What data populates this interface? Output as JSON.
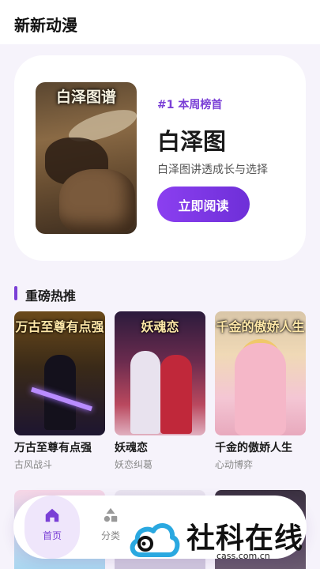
{
  "app": {
    "title": "新新动漫"
  },
  "hero": {
    "cover_title": "白泽图谱",
    "rank_label": "#1 本周榜首",
    "title": "白泽图",
    "description": "白泽图讲透成长与选择",
    "read_button": "立即阅读"
  },
  "section": {
    "title": "重磅热推"
  },
  "cards": [
    {
      "cover_title": "万古至尊有点强",
      "name": "万古至尊有点强",
      "tag": "古风战斗"
    },
    {
      "cover_title": "妖魂恋",
      "name": "妖魂恋",
      "tag": "妖恋纠葛"
    },
    {
      "cover_title": "千金的傲娇人生",
      "name": "千金的傲娇人生",
      "tag": "心动博弈"
    }
  ],
  "tabs": [
    {
      "label": "首页",
      "icon": "home-icon",
      "active": true
    },
    {
      "label": "分类",
      "icon": "category-icon",
      "active": false
    }
  ],
  "watermark": {
    "text": "社科在线",
    "url": "cass.com.cn"
  },
  "colors": {
    "accent": "#7a3fd6",
    "background": "#f6f3fb"
  }
}
